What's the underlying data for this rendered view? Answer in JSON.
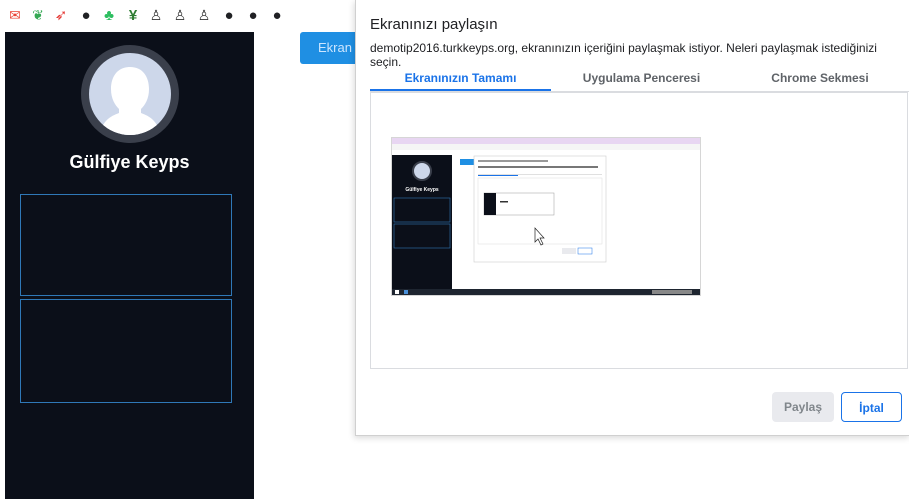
{
  "bookmarks": [
    {
      "icon": "gmail-icon",
      "glyph": "✉",
      "color": "#ea4335"
    },
    {
      "icon": "leaf-icon",
      "glyph": "❦",
      "color": "#34a853"
    },
    {
      "icon": "rocket-icon",
      "glyph": "➶",
      "color": "#e53935"
    },
    {
      "icon": "globe-icon",
      "glyph": "●",
      "color": "#202124"
    },
    {
      "icon": "evernote-icon",
      "glyph": "♣",
      "color": "#2dbe60"
    },
    {
      "icon": "yen-icon",
      "glyph": "¥",
      "color": "#2e7d32"
    },
    {
      "icon": "runner-icon",
      "glyph": "♙",
      "color": "#333333"
    },
    {
      "icon": "runner-icon",
      "glyph": "♙",
      "color": "#333333"
    },
    {
      "icon": "runner-icon",
      "glyph": "♙",
      "color": "#333333"
    },
    {
      "icon": "globe-icon",
      "glyph": "●",
      "color": "#202124"
    },
    {
      "icon": "globe-icon",
      "glyph": "●",
      "color": "#202124"
    },
    {
      "icon": "globe-icon",
      "glyph": "●",
      "color": "#202124"
    }
  ],
  "sidebar": {
    "user_name": "Gülfiye Keyps"
  },
  "background_button": {
    "label": "Ekran"
  },
  "dialog": {
    "title": "Ekranınızı paylaşın",
    "subtitle": "demotip2016.turkkeyps.org, ekranınızın içeriğini paylaşmak istiyor. Neleri paylaşmak istediğinizi seçin.",
    "tabs": [
      {
        "label": "Ekranınızın Tamamı",
        "active": true
      },
      {
        "label": "Uygulama Penceresi",
        "active": false
      },
      {
        "label": "Chrome Sekmesi",
        "active": false
      }
    ],
    "share_label": "Paylaş",
    "cancel_label": "İptal"
  },
  "thumbnail": {
    "user_name": "Gülfiye Keyps"
  },
  "colors": {
    "sidebar_bg": "#0b0f19",
    "accent": "#1a73e8",
    "panel_border": "#2f78b7"
  }
}
